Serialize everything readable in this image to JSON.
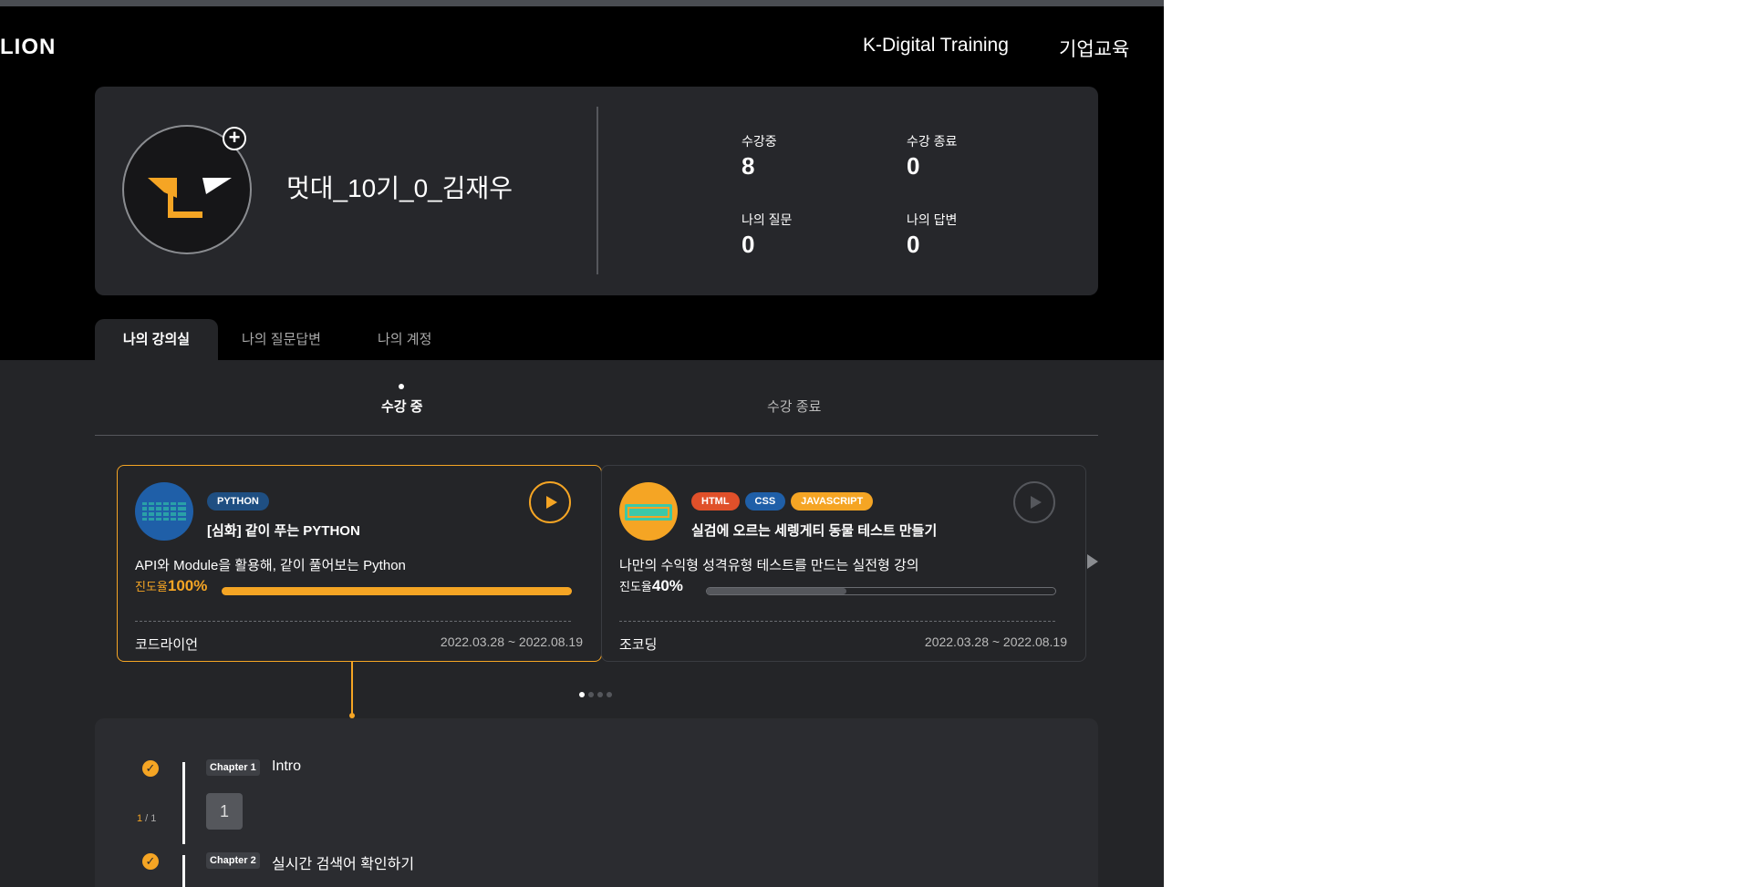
{
  "header": {
    "logo": "LION",
    "nav": [
      "K-Digital Training",
      "기업교육"
    ]
  },
  "profile": {
    "username": "멋대_10기_0_김재우",
    "add_icon": "plus-icon",
    "stats": [
      {
        "label": "수강중",
        "value": "8"
      },
      {
        "label": "수강 종료",
        "value": "0"
      },
      {
        "label": "나의 질문",
        "value": "0"
      },
      {
        "label": "나의 답변",
        "value": "0"
      }
    ]
  },
  "tabs": [
    "나의 강의실",
    "나의 질문답변",
    "나의 계정"
  ],
  "subtabs": [
    "수강 중",
    "수강 종료"
  ],
  "courses": [
    {
      "tags": [
        {
          "label": "PYTHON",
          "color": "#1f4f82"
        }
      ],
      "title": "[심화] 같이 푸는 PYTHON",
      "description": "API와 Module을 활용해, 같이 풀어보는 Python",
      "progress_label": "진도율",
      "progress_value": "100%",
      "progress": 1.0,
      "provider": "코드라이언",
      "dates": "2022.03.28 ~ 2022.08.19"
    },
    {
      "tags": [
        {
          "label": "HTML",
          "color": "#e0502a"
        },
        {
          "label": "CSS",
          "color": "#1f5fa8"
        },
        {
          "label": "JAVASCRIPT",
          "color": "#f5a524"
        }
      ],
      "title": "실검에 오르는 세렝게티 동물 테스트 만들기",
      "description": "나만의 수익형 성격유형 테스트를 만드는 실전형 강의",
      "progress_label": "진도율",
      "progress_value": "40%",
      "progress": 0.4,
      "provider": "조코딩",
      "dates": "2022.03.28 ~ 2022.08.19"
    }
  ],
  "chapters": [
    {
      "tag": "Chapter 1",
      "title": "Intro",
      "lesson": "1",
      "done": "1",
      "total": "1"
    },
    {
      "tag": "Chapter 2",
      "title": "실시간 검색어 확인하기"
    }
  ],
  "colors": {
    "accent": "#f5a524",
    "panel": "#26272b",
    "background": "#242528"
  }
}
